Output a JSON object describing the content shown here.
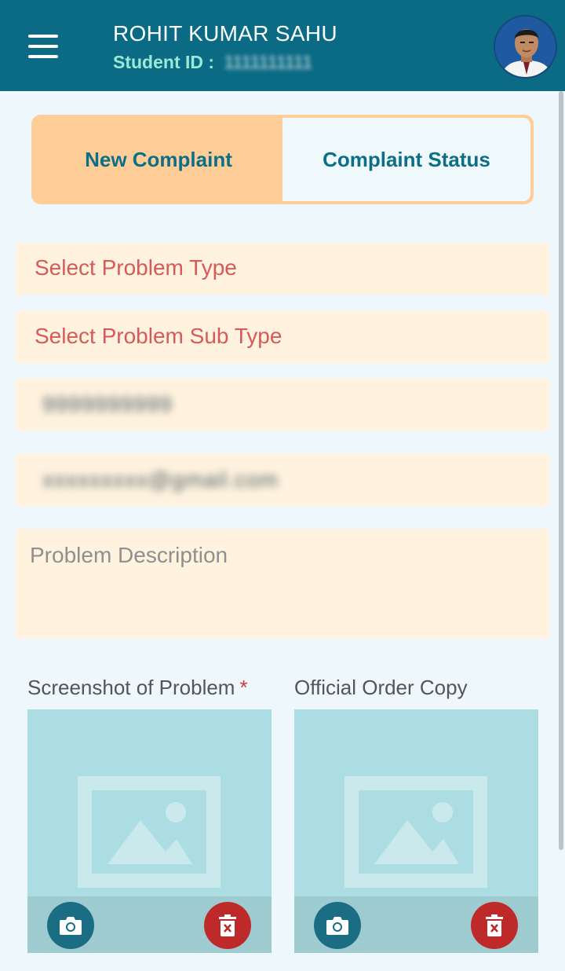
{
  "header": {
    "user_name": "ROHIT KUMAR SAHU",
    "student_id_label": "Student ID :",
    "student_id_value": "1111111111"
  },
  "tabs": [
    {
      "label": "New Complaint",
      "active": true
    },
    {
      "label": "Complaint Status",
      "active": false
    }
  ],
  "form": {
    "problem_type_placeholder": "Select Problem Type",
    "problem_subtype_placeholder": "Select Problem Sub Type",
    "phone_value": "9999999999",
    "email_value": "xxxxxxxxx@gmail.com",
    "description_placeholder": "Problem Description"
  },
  "uploads": [
    {
      "label": "Screenshot of Problem",
      "required": true,
      "required_mark": "*"
    },
    {
      "label": "Official Order Copy",
      "required": false
    }
  ],
  "icons": {
    "menu": "hamburger-menu-icon",
    "camera": "camera-icon",
    "delete": "trash-icon",
    "placeholder": "image-placeholder-icon"
  },
  "colors": {
    "header_bg": "#0b6b85",
    "accent": "#ffcd98",
    "field_bg": "#fff3df",
    "placeholder_red": "#d65a5a",
    "delete_red": "#be2a2a",
    "upload_bg": "#acdde2"
  }
}
